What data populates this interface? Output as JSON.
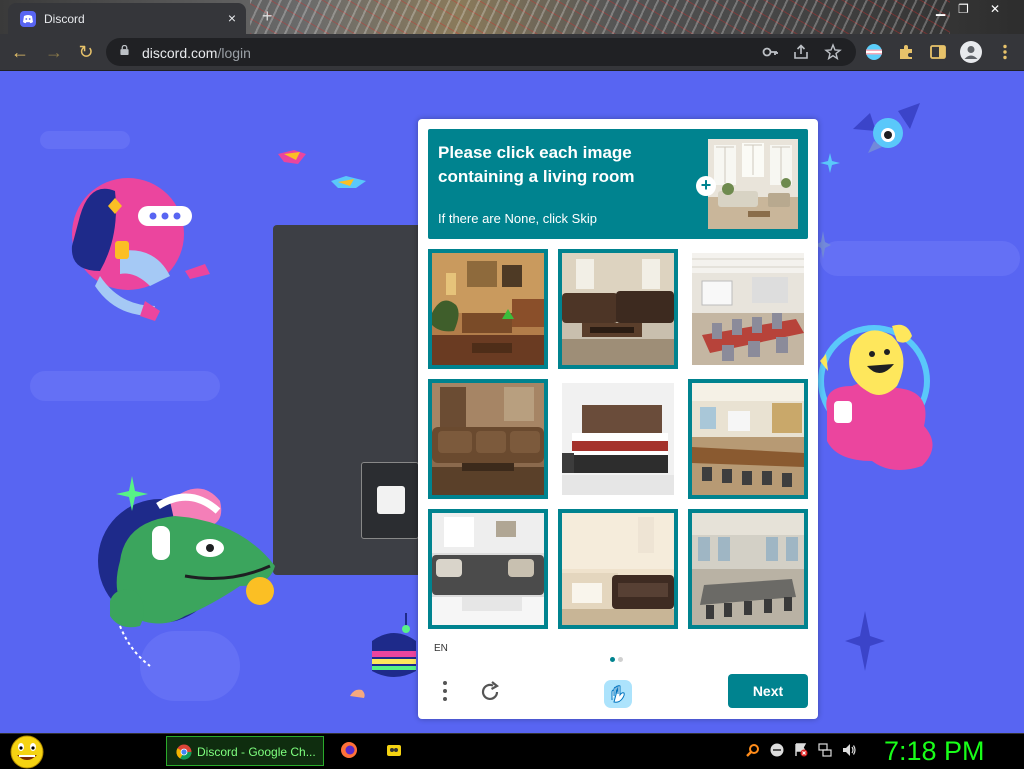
{
  "browser": {
    "tab_title": "Discord",
    "tab_close": "×",
    "new_tab": "+",
    "url_domain": "discord.com",
    "url_path": "/login"
  },
  "captcha": {
    "prompt_line1": "Please click each image",
    "prompt_line2": "containing a living room",
    "prompt_hint": "If there are None, click Skip",
    "language": "EN",
    "next_label": "Next",
    "page_indicator": {
      "current": 1,
      "total": 2
    },
    "tiles": [
      {
        "scene": "living-room",
        "selected": false
      },
      {
        "scene": "living-room",
        "selected": false
      },
      {
        "scene": "meeting-room",
        "selected": false
      },
      {
        "scene": "living-room",
        "selected": false
      },
      {
        "scene": "bedroom",
        "selected": false
      },
      {
        "scene": "meeting-room",
        "selected": false
      },
      {
        "scene": "living-room",
        "selected": false
      },
      {
        "scene": "living-room",
        "selected": false
      },
      {
        "scene": "meeting-room",
        "selected": false
      }
    ],
    "colors": {
      "accent": "#00838f"
    }
  },
  "taskbar": {
    "active_task": "Discord - Google Ch...",
    "clock": "7:18 PM"
  },
  "colors": {
    "discord_blurple": "#5865f2",
    "clock_green": "#19ff19"
  }
}
